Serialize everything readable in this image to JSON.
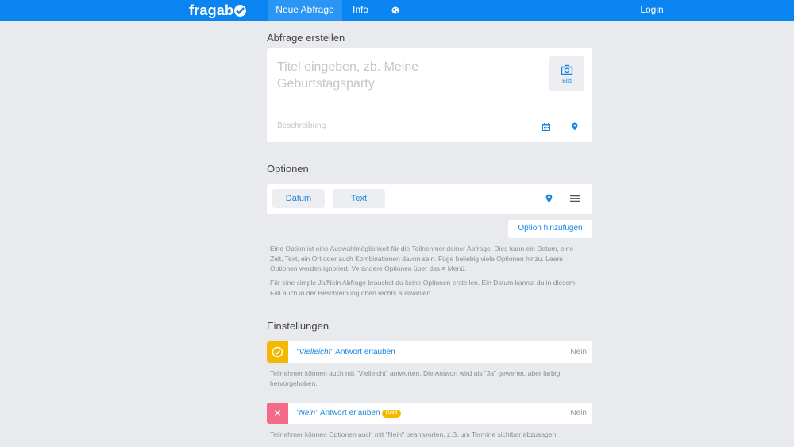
{
  "nav": {
    "logo": "fragab",
    "new_survey": "Neue Abfrage",
    "info": "Info",
    "login": "Login"
  },
  "create": {
    "heading": "Abfrage erstellen",
    "title_placeholder": "Titel eingeben, zb. Meine Geburtstagsparty",
    "image_label": "Bild",
    "description_placeholder": "Beschreibung"
  },
  "options": {
    "heading": "Optionen",
    "tabs": [
      "Datum",
      "Text"
    ],
    "add_button": "Option hinzufügen",
    "help_1": "Eine Option ist eine Auswahlmöglichkeit für die Teilnehmer deiner Abfrage. Dies kann ein Datum, eine Zeit, Text, ein Ort oder auch Kombinationen davon sein. Füge beliebig viele Optionen hinzu. Leere Optionen werden ignoriert. Verändere Optionen über das ≡ Menü.",
    "help_2": "Für eine simple Ja/Nein Abfrage brauchst du keine Optionen erstellen. Ein Datum kannst du in diesem Fall auch in der Beschreibung oben rechts auswählen"
  },
  "settings": {
    "heading": "Einstellungen",
    "items": [
      {
        "label_quoted": "\"Vielleicht\"",
        "label_rest": " Antwort erlauben",
        "value": "Nein",
        "badge": "",
        "color": "#f5b800",
        "icon": "check-circle-icon",
        "help": "Teilnehmer können auch mit \"Vielleicht\" antworten. Die Antwort wird als \"Ja\" gewertet, aber farbig hervorgehoben."
      },
      {
        "label_quoted": "\"Nein\"",
        "label_rest": " Antwort erlauben",
        "value": "Nein",
        "badge": "Gold",
        "color": "#f46b8a",
        "icon": "close-icon",
        "help": "Teilnehmer können Optionen auch mit \"Nein\" beantworten, z.B. um Termine sichtbar abzusagen."
      }
    ]
  },
  "colors": {
    "accent": "#0a84f0",
    "link": "#1a86e0",
    "background": "#e9eaee"
  }
}
